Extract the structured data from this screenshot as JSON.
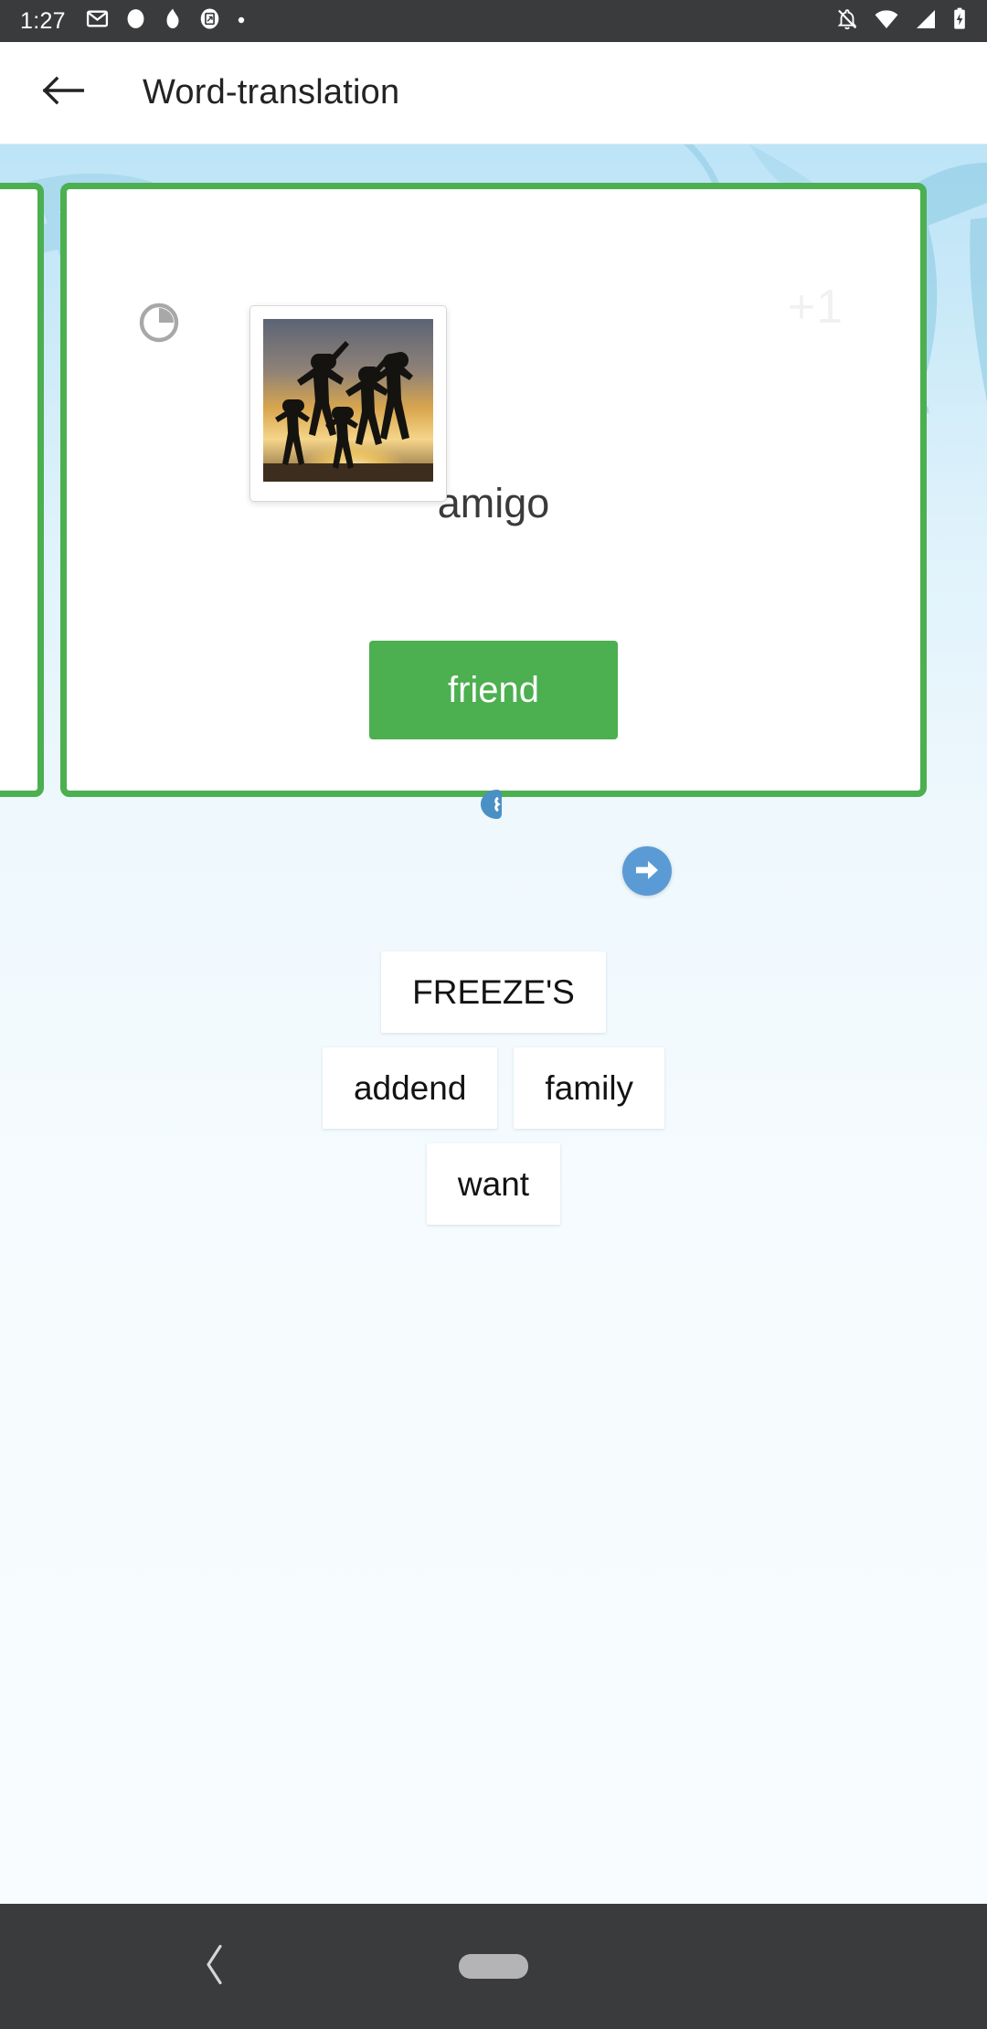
{
  "status_bar": {
    "time": "1:27",
    "left_icons": [
      "gmail-icon",
      "circle-dot-icon",
      "flame-icon",
      "screenshot-icon",
      "small-dot-icon"
    ],
    "right_icons": [
      "notifications-off-icon",
      "wifi-icon",
      "cellular-signal-icon",
      "battery-charging-icon"
    ]
  },
  "app_bar": {
    "back_icon": "back-arrow-icon",
    "title": "Word-translation"
  },
  "card": {
    "timer_icon": "pie-timer-icon",
    "timer_progress_percent": 25,
    "score_badge": "+1",
    "prompt_word": "amigo",
    "answer_label": "friend",
    "speaker_icon": "speaker-icon",
    "image_alt": "silhouettes-jumping-at-sunset-photo",
    "border_color": "#4caf50",
    "answer_button_color": "#4caf50"
  },
  "next_button": {
    "icon": "arrow-right-icon",
    "color": "#5b9bd5"
  },
  "options": {
    "rows": [
      [
        "FREEZE'S"
      ],
      [
        "addend",
        "family"
      ],
      [
        "want"
      ]
    ]
  },
  "nav_bar": {
    "back_icon": "nav-back-chevron-icon",
    "home_handle": "home-pill-handle"
  }
}
